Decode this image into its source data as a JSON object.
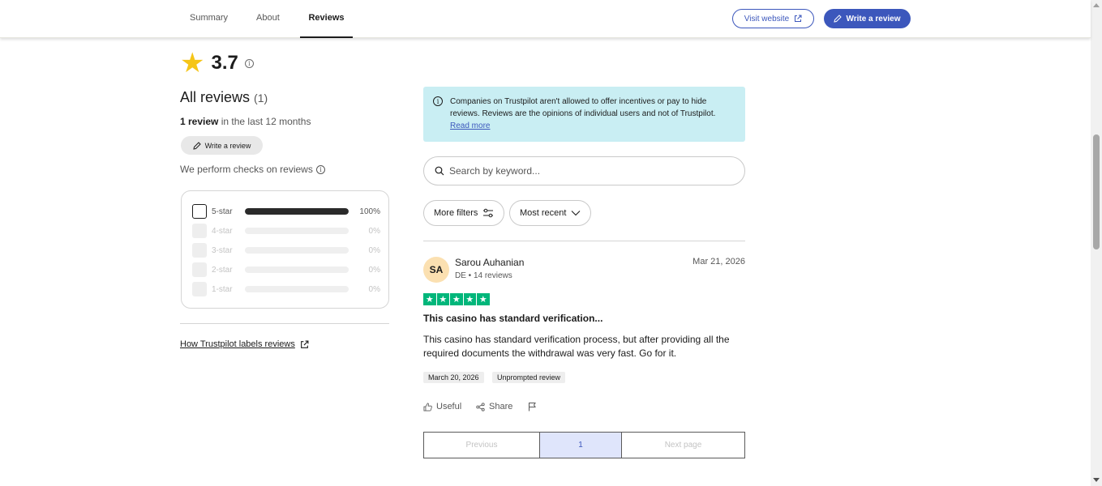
{
  "nav": {
    "tabs": [
      {
        "label": "Summary",
        "active": false
      },
      {
        "label": "About",
        "active": false
      },
      {
        "label": "Reviews",
        "active": true
      }
    ],
    "visit_website": "Visit website",
    "write_review": "Write a review"
  },
  "summary": {
    "rating": "3.7",
    "all_reviews_label": "All reviews",
    "all_reviews_count": "(1)",
    "recent_count": "1 review",
    "recent_suffix": " in the last 12 months",
    "write_review": "Write a review",
    "checks_text": "We perform checks on reviews",
    "how_labels": "How Trustpilot labels reviews"
  },
  "star_filters": [
    {
      "label": "5-star",
      "percent": "100%",
      "fraction": 1.0,
      "enabled": true
    },
    {
      "label": "4-star",
      "percent": "0%",
      "fraction": 0,
      "enabled": false
    },
    {
      "label": "3-star",
      "percent": "0%",
      "fraction": 0,
      "enabled": false
    },
    {
      "label": "2-star",
      "percent": "0%",
      "fraction": 0,
      "enabled": false
    },
    {
      "label": "1-star",
      "percent": "0%",
      "fraction": 0,
      "enabled": false
    }
  ],
  "notice": {
    "text": "Companies on Trustpilot aren't allowed to offer incentives or pay to hide reviews. Reviews are the opinions of individual users and not of Trustpilot.",
    "link": "Read more"
  },
  "search": {
    "placeholder": "Search by keyword..."
  },
  "filters": {
    "more_filters": "More filters",
    "sort": "Most recent"
  },
  "review": {
    "initials": "SA",
    "name": "Sarou Auhanian",
    "meta": "DE • 14 reviews",
    "date": "Mar 21, 2026",
    "stars": 5,
    "title": "This casino has standard verification...",
    "body": "This casino has standard verification process, but after providing all the required documents the withdrawal was very fast. Go for it.",
    "experience_date": "March 20, 2026",
    "tag": "Unprompted review",
    "useful": "Useful",
    "share": "Share"
  },
  "pagination": {
    "previous": "Previous",
    "current": "1",
    "next": "Next page"
  },
  "colors": {
    "brand_blue": "#3c57bc",
    "trust_green": "#00b67a",
    "star_yellow": "#f5c518",
    "notice_bg": "#c9eef3"
  }
}
